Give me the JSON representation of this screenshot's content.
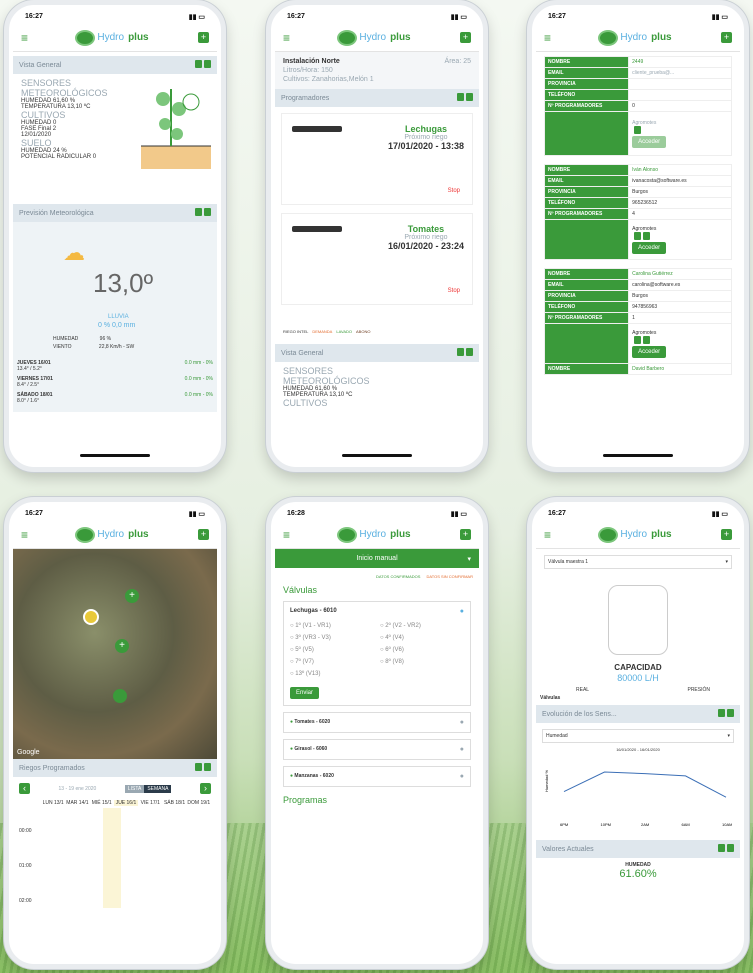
{
  "status": {
    "time_a": "16:27",
    "time_b": "16:28",
    "signal": "4G"
  },
  "app": {
    "logo": "Hydro",
    "logo_bold": "plus"
  },
  "p1": {
    "vista": "Vista General",
    "sensores": "SENSORES METEOROLÓGICOS",
    "humedad_k": "HUMEDAD",
    "humedad_v": "61,60 %",
    "temp_k": "TEMPERATURA",
    "temp_v": "13,10 ºC",
    "cultivos": "CULTIVOS",
    "hum2_k": "HUMEDAD",
    "hum2_v": "0",
    "fase_k": "FASE",
    "fase_v": "Final 2",
    "fecha": "12/01/2020",
    "suelo": "SUELO",
    "hum3_k": "HUMEDAD",
    "hum3_v": "24 %",
    "pot_k": "POTENCIAL RADICULAR",
    "pot_v": "0",
    "meteo": "Previsión Meteorológica",
    "temp": "13,0º",
    "lluvia": "LLUVIA",
    "lluvia_v": "0 % 0,0 mm",
    "hum_k": "HUMEDAD",
    "hum_v": "96 %",
    "viento_k": "VIENTO",
    "viento_v": "22,8 Km/h - SW",
    "days": [
      {
        "d": "JUEVES 16/01",
        "t": "13.4° / 5.2°",
        "r": "0.0 mm - 0%"
      },
      {
        "d": "VIERNES 17/01",
        "t": "8.4° / 2.5°",
        "r": "0.0 mm - 0%"
      },
      {
        "d": "SÁBADO 18/01",
        "t": "8.0° / 1.6°",
        "r": "0.0 mm - 0%"
      }
    ]
  },
  "p2": {
    "inst": "Instalación Norte",
    "area": "Área: 25",
    "lh": "Litros/Hora: 150",
    "cult": "Cultivos: Zanahorias,Melón 1",
    "prog": "Programadores",
    "c1": "Lechugas",
    "c1s": "Próximo riego",
    "c1d": "17/01/2020 - 13:38",
    "c2": "Tomates",
    "c2s": "Próximo riego",
    "c2d": "16/01/2020 - 23:24",
    "stop": "Stop",
    "legend": [
      "RIEGO INTEL",
      "DEMANDA",
      "LAVADO",
      "ABONO"
    ],
    "vista": "Vista General",
    "sensores": "SENSORES METEOROLÓGICOS",
    "humedad_v": "61,60 %",
    "temp_v": "13,10 ºC",
    "cultivos": "CULTIVOS"
  },
  "p3": {
    "rows1": [
      [
        "NOMBRE",
        "2449"
      ],
      [
        "EMAIL",
        "cliente_prueba@..."
      ],
      [
        "PROVINCIA",
        ""
      ],
      [
        "TELÉFONO",
        ""
      ],
      [
        "Nº PROGRAMADORES",
        "0"
      ]
    ],
    "btn1": "Acceder",
    "rows2": [
      [
        "NOMBRE",
        "Iván Alonso"
      ],
      [
        "EMAIL",
        "ivanacosta@software.es"
      ],
      [
        "PROVINCIA",
        "Burgos"
      ],
      [
        "TELÉFONO",
        "965236512"
      ],
      [
        "Nº PROGRAMADORES",
        "4"
      ]
    ],
    "agro": "Agromotes",
    "btn2": "Acceder",
    "rows3": [
      [
        "NOMBRE",
        "Carolina Gutiérrez"
      ],
      [
        "EMAIL",
        "carolina@software.es"
      ],
      [
        "PROVINCIA",
        "Burgos"
      ],
      [
        "TELÉFONO",
        "947856963"
      ],
      [
        "Nº PROGRAMADORES",
        "1"
      ]
    ],
    "btn3": "Acceder",
    "last": "David Barbero"
  },
  "p4": {
    "google": "Google",
    "riegos": "Riegos Programados",
    "week": "13 - 19 ene 2020",
    "lista": "LISTA",
    "semana": "SEMANA",
    "days": [
      "LUN 13/1",
      "MAR 14/1",
      "MIÉ 15/1",
      "JUE 16/1",
      "VIE 17/1",
      "SÁB 18/1",
      "DOM 19/1"
    ],
    "times": [
      "00:00",
      "01:00",
      "02:00"
    ]
  },
  "p5": {
    "inicio": "Inicio manual",
    "l1": "DATOS CONFIRMADOS",
    "l2": "DATOS SIN CONFIRMAR",
    "valvulas": "Válvulas",
    "g1": "Lechugas - 6010",
    "opts": [
      "1º (V1 - VR1)",
      "2º (V2 - VR2)",
      "3º (VR3 - V3)",
      "4º (V4)",
      "5º (V5)",
      "6º (V6)",
      "7º (V7)",
      "8º (V8)",
      "13º (V13)"
    ],
    "enviar": "Enviar",
    "g2": "Tomates - 6020",
    "g3": "Girasol - 6060",
    "g4": "Manzanas - 6020",
    "programas": "Programas"
  },
  "p6": {
    "valv": "Válvula maestra 1",
    "cap": "CAPACIDAD",
    "cap_v": "80000 L/H",
    "real": "REAL",
    "presion": "PRESIÓN",
    "valvulas": "Válvulas",
    "evol": "Evolución de los Sens...",
    "sel": "Humedad",
    "range": "16/01/2020 - 16/01/2020",
    "xt": [
      "6PM",
      "10PM",
      "2AM",
      "6AM",
      "10AM"
    ],
    "yl": "Humedad %",
    "valores": "Valores Actuales",
    "hum": "HUMEDAD",
    "hum_v": "61.60%"
  },
  "chart_data": {
    "type": "line",
    "title": "",
    "xlabel": "",
    "ylabel": "Humedad %",
    "x": [
      "6PM",
      "10PM",
      "2AM",
      "6AM",
      "10AM"
    ],
    "series": [
      {
        "values": [
          40,
          75,
          72,
          68,
          30
        ]
      }
    ]
  }
}
